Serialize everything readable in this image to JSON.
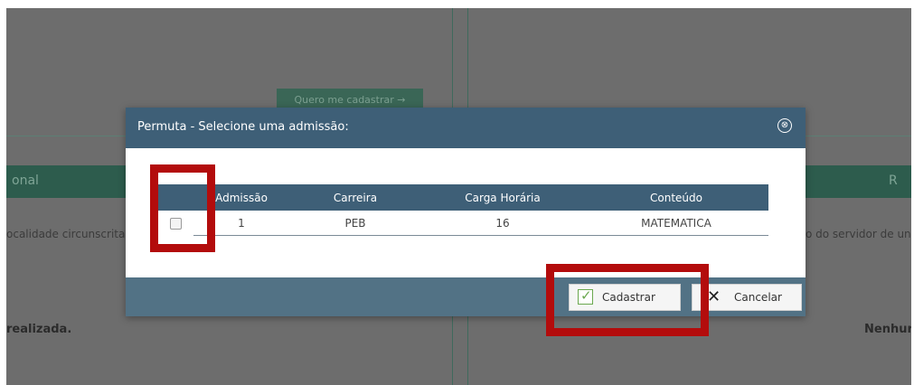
{
  "background": {
    "register_button": "Quero me cadastrar →",
    "left_band_label": "onal",
    "right_band_label": "R",
    "left_text": "ocalidade circunscrita",
    "right_text": "o do servidor de un",
    "left_bold": "realizada.",
    "right_bold": "Nenhur"
  },
  "modal": {
    "title": "Permuta - Selecione uma admissão:",
    "close_glyph": "⊗",
    "table": {
      "headers": [
        "",
        "Admissão",
        "Carreira",
        "Carga Horária",
        "Conteúdo"
      ],
      "rows": [
        {
          "admissao": "1",
          "carreira": "PEB",
          "carga_horaria": "16",
          "conteudo": "MATEMATICA",
          "checked": false
        }
      ]
    },
    "footer": {
      "cadastrar_label": "Cadastrar",
      "cancelar_label": "Cancelar",
      "check_glyph": "✓",
      "x_glyph": "✕"
    }
  },
  "colors": {
    "header": "#3e5f77",
    "footer": "#527285",
    "highlight": "#b30c0c",
    "check": "#6aa84f",
    "page_green": "#2d5c4d"
  }
}
